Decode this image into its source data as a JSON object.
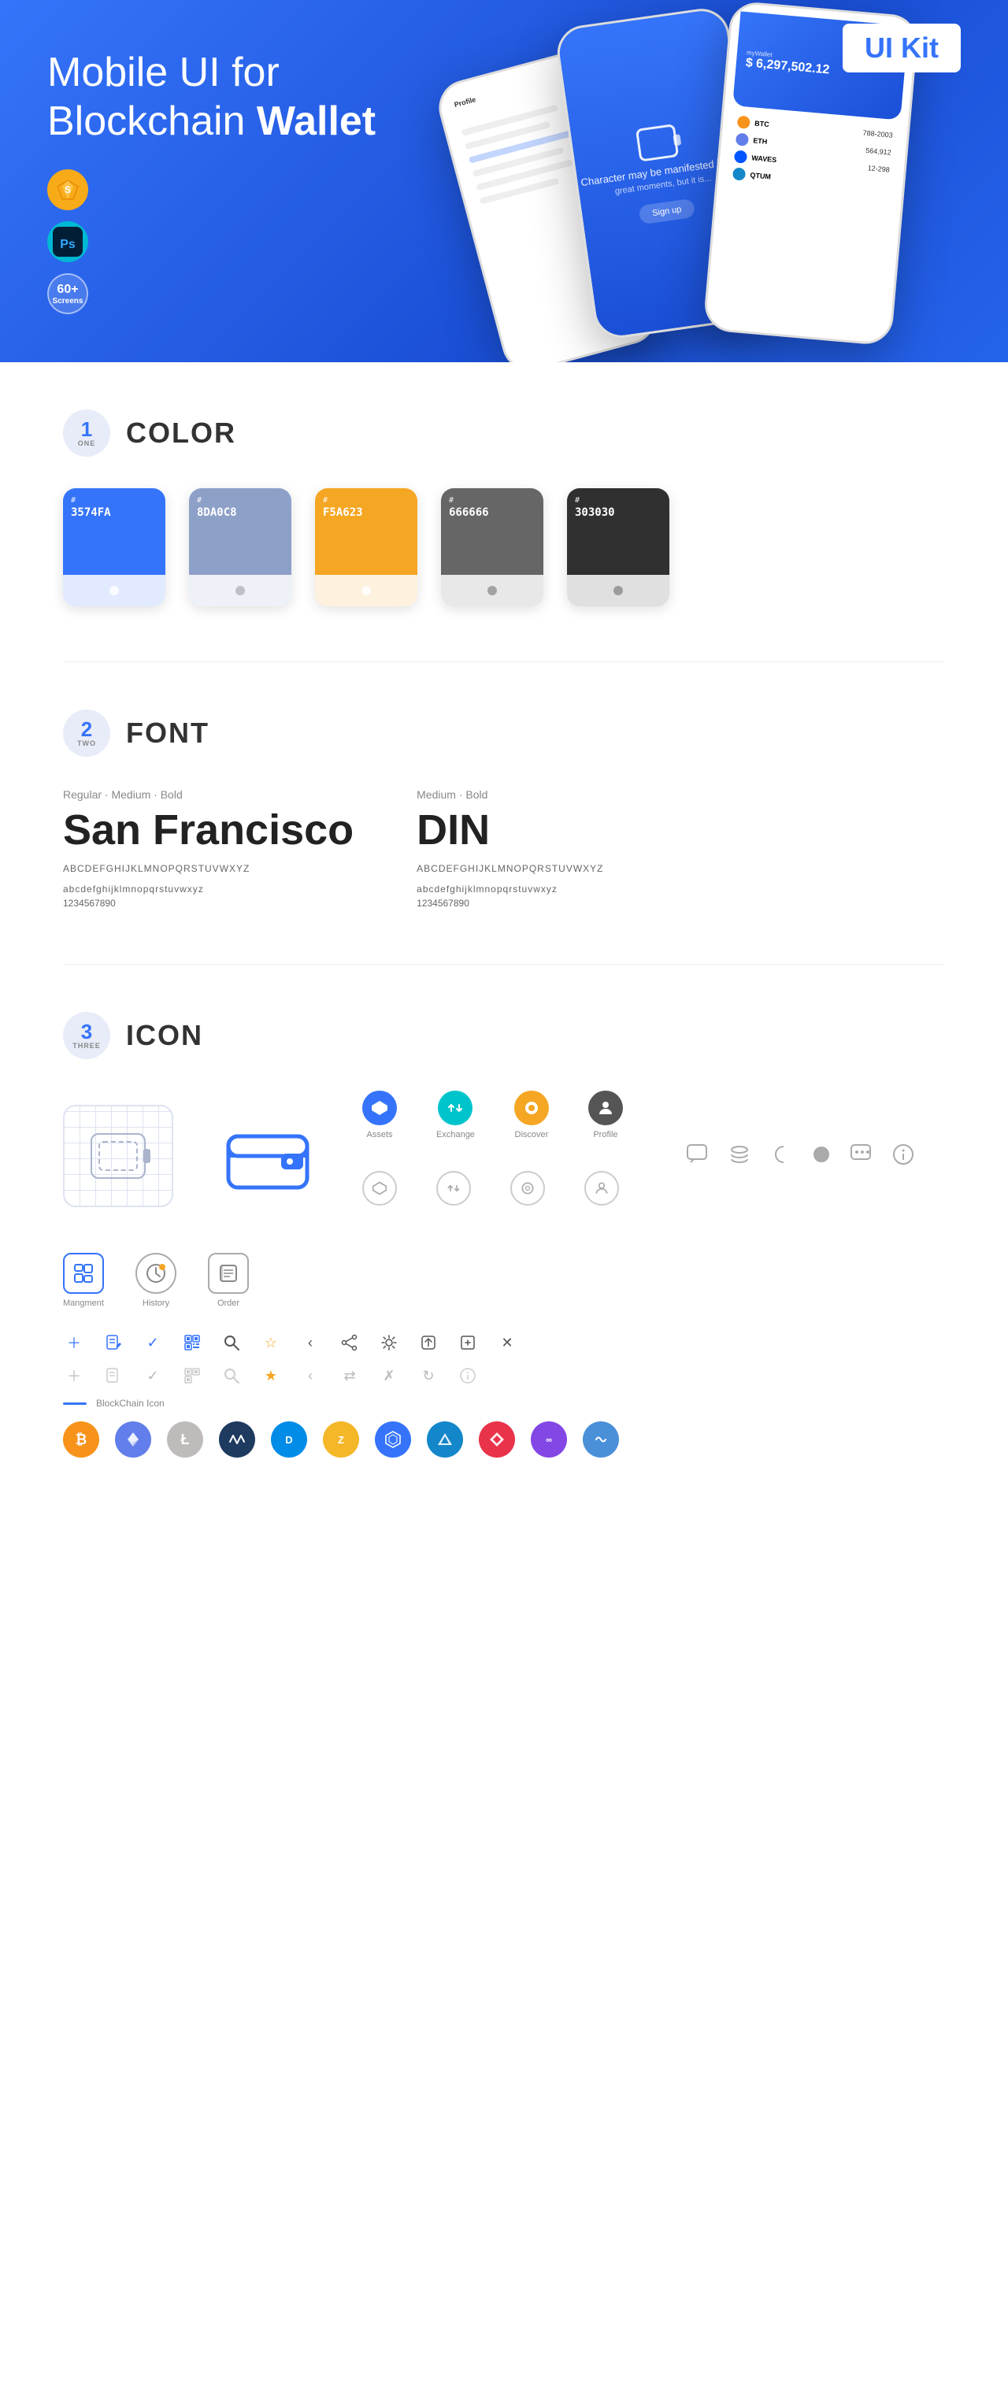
{
  "hero": {
    "title_plain": "Mobile UI for Blockchain ",
    "title_bold": "Wallet",
    "ui_kit_badge": "UI Kit",
    "badge_sketch": "S",
    "badge_ps": "Ps",
    "badge_screens_count": "60+",
    "badge_screens_label": "Screens",
    "phone_amount": "$ 6,297,502.12",
    "phone_wallet_label": "myWallet"
  },
  "sections": {
    "color": {
      "number": "1",
      "word": "ONE",
      "title": "COLOR",
      "swatches": [
        {
          "hex": "#3574FA",
          "code": "3574FA",
          "label": "#"
        },
        {
          "hex": "#8D A0C8",
          "code": "8DA0C8",
          "label": "#"
        },
        {
          "hex": "#F5A623",
          "code": "F5A623",
          "label": "#"
        },
        {
          "hex": "#666666",
          "code": "666666",
          "label": "#"
        },
        {
          "hex": "#303030",
          "code": "303030",
          "label": "#"
        }
      ]
    },
    "font": {
      "number": "2",
      "word": "TWO",
      "title": "FONT",
      "font1": {
        "style": "Regular · Medium · Bold",
        "name": "San Francisco",
        "uppercase": "ABCDEFGHIJKLMNOPQRSTUVWXYZ",
        "lowercase": "abcdefghijklmnopqrstuvwxyz",
        "numbers": "1234567890"
      },
      "font2": {
        "style": "Medium · Bold",
        "name": "DIN",
        "uppercase": "ABCDEFGHIJKLMNOPQRSTUVWXYZ",
        "lowercase": "abcdefghijklmnopqrstuvwxyz",
        "numbers": "1234567890"
      }
    },
    "icon": {
      "number": "3",
      "word": "THREE",
      "title": "ICON",
      "nav_icons": [
        {
          "label": "Assets",
          "color": "blue"
        },
        {
          "label": "Exchange",
          "color": "teal"
        },
        {
          "label": "Discover",
          "color": "orange"
        },
        {
          "label": "Profile",
          "color": "dark"
        }
      ],
      "bottom_nav": [
        {
          "label": "Mangment"
        },
        {
          "label": "History"
        },
        {
          "label": "Order"
        }
      ],
      "blockchain_label": "BlockChain Icon",
      "crypto": [
        {
          "symbol": "₿",
          "name": "Bitcoin",
          "color": "#F7931A"
        },
        {
          "symbol": "Ξ",
          "name": "Ethereum",
          "color": "#627EEA"
        },
        {
          "symbol": "Ł",
          "name": "Litecoin",
          "color": "#BFBBBB"
        },
        {
          "symbol": "W",
          "name": "Waves",
          "color": "#0155FF"
        },
        {
          "symbol": "D",
          "name": "Dash",
          "color": "#008CE7"
        },
        {
          "symbol": "Z",
          "name": "Zcash",
          "color": "#F4B728"
        },
        {
          "symbol": "◈",
          "name": "Grid",
          "color": "#3574FA"
        },
        {
          "symbol": "▲",
          "name": "Stratis",
          "color": "#1387C9"
        },
        {
          "symbol": "◆",
          "name": "Ark",
          "color": "#F70000"
        },
        {
          "symbol": "∞",
          "name": "Matic",
          "color": "#8247E5"
        },
        {
          "symbol": "~",
          "name": "Poly",
          "color": "#4A90D9"
        }
      ]
    }
  }
}
